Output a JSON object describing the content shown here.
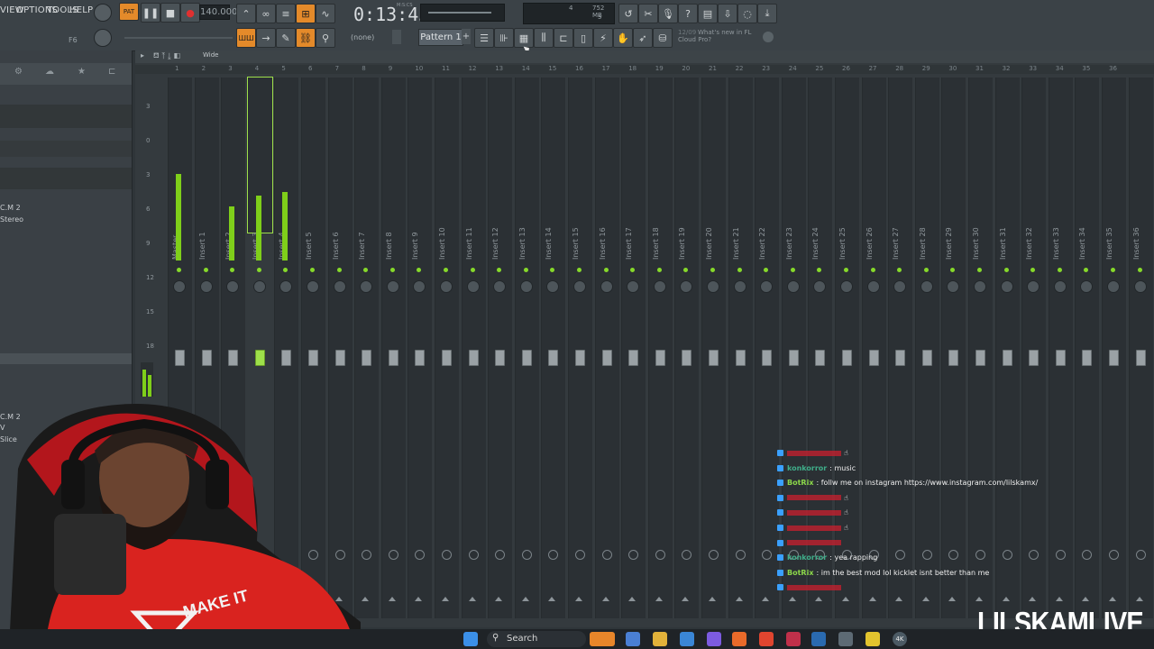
{
  "menu": {
    "view": "VIEW",
    "options": "OPTIONS",
    "tools": "TOOLS",
    "help": "HELP"
  },
  "transport": {
    "tempo": "140.000",
    "time": "0:13:45",
    "time_unit": "M:S:CS",
    "memory": "752 MB",
    "cpu": "4",
    "voices": "5",
    "key_hint": "F6"
  },
  "toolbar": {
    "pattern_label": "Pattern 1",
    "snap_label": "(none)",
    "news_date": "12/09",
    "news_text": "What's new in FL Cloud Pro?"
  },
  "mixer": {
    "wide_label": "Wide",
    "db_scale": [
      "3",
      "0",
      "3",
      "6",
      "9",
      "12",
      "15",
      "18"
    ],
    "ruler": [
      "1",
      "2",
      "3",
      "4",
      "5",
      "6",
      "7",
      "8",
      "9",
      "10",
      "11",
      "12",
      "13",
      "14",
      "15",
      "16",
      "17",
      "18",
      "19",
      "20",
      "21",
      "22",
      "23",
      "24",
      "25",
      "26",
      "27",
      "28",
      "29",
      "30",
      "31",
      "32",
      "33",
      "34",
      "35",
      "36"
    ],
    "tracks": [
      "Master",
      "Insert 1",
      "Insert 2",
      "Insert 3",
      "Insert 4",
      "Insert 5",
      "Insert 6",
      "Insert 7",
      "Insert 8",
      "Insert 9",
      "Insert 10",
      "Insert 11",
      "Insert 12",
      "Insert 13",
      "Insert 14",
      "Insert 15",
      "Insert 16",
      "Insert 17",
      "Insert 18",
      "Insert 19",
      "Insert 20",
      "Insert 21",
      "Insert 22",
      "Insert 23",
      "Insert 24",
      "Insert 25",
      "Insert 26",
      "Insert 27",
      "Insert 28",
      "Insert 29",
      "Insert 30",
      "Insert 31",
      "Insert 32",
      "Insert 33",
      "Insert 34",
      "Insert 35",
      "Insert 36"
    ],
    "selected_track": "Insert 3",
    "levels": [
      0.48,
      0.0,
      0.3,
      0.36,
      0.38
    ]
  },
  "browser": {
    "out1": "C.M 2",
    "out1_mode": "Stereo",
    "out2": "C.M 2",
    "out2_mode": "V",
    "out2_extra": "Slice"
  },
  "chat": [
    {
      "user": "",
      "msg": "☝",
      "color": "#c0202e"
    },
    {
      "user": "konkorror",
      "msg": ": music",
      "color": "#3fae8a"
    },
    {
      "user": "BotRix",
      "msg": ": follw me on instagram https://www.instagram.com/lilskamx/",
      "color": "#8bd64a"
    },
    {
      "user": "",
      "msg": "☝",
      "color": "#c0202e"
    },
    {
      "user": "",
      "msg": "☝",
      "color": "#c0202e"
    },
    {
      "user": "",
      "msg": "☝",
      "color": "#c0202e"
    },
    {
      "user": "",
      "msg": "",
      "color": "#c0202e"
    },
    {
      "user": "konkorror",
      "msg": ": yea rapping",
      "color": "#3fae8a"
    },
    {
      "user": "BotRix",
      "msg": ": im the best mod lol kicklet isnt better than me",
      "color": "#8bd64a"
    },
    {
      "user": "",
      "msg": "",
      "color": "#c0202e"
    }
  ],
  "taskbar": {
    "search": "Search",
    "badge": "4K"
  },
  "branding": {
    "text": "LILSKAMLIVE"
  },
  "colors": {
    "accent_green": "#7fcf1a",
    "accent_orange": "#e48a2a",
    "bg": "#343a3e"
  }
}
